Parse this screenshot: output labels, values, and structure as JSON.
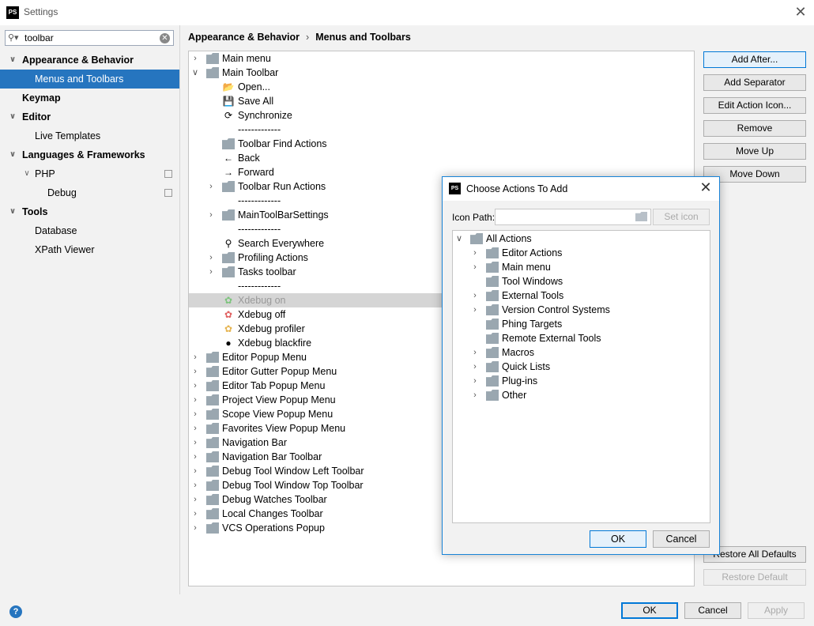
{
  "window": {
    "app_icon": "PS",
    "title": "Settings"
  },
  "search": {
    "value": "toolbar"
  },
  "sidebar": {
    "items": [
      {
        "label": "Appearance & Behavior"
      },
      {
        "label": "Menus and Toolbars"
      },
      {
        "label": "Keymap"
      },
      {
        "label": "Editor"
      },
      {
        "label": "Live Templates"
      },
      {
        "label": "Languages & Frameworks"
      },
      {
        "label": "PHP"
      },
      {
        "label": "Debug"
      },
      {
        "label": "Tools"
      },
      {
        "label": "Database"
      },
      {
        "label": "XPath Viewer"
      }
    ]
  },
  "breadcrumb": {
    "parent": "Appearance & Behavior",
    "sep": "›",
    "current": "Menus and Toolbars"
  },
  "tree": {
    "rows": [
      {
        "label": "Main menu"
      },
      {
        "label": "Main Toolbar"
      },
      {
        "label": "Open..."
      },
      {
        "label": "Save All"
      },
      {
        "label": "Synchronize"
      },
      {
        "label": "-------------"
      },
      {
        "label": "Toolbar Find Actions"
      },
      {
        "label": "Back"
      },
      {
        "label": "Forward"
      },
      {
        "label": "Toolbar Run Actions"
      },
      {
        "label": "-------------"
      },
      {
        "label": "MainToolBarSettings"
      },
      {
        "label": "-------------"
      },
      {
        "label": "Search Everywhere"
      },
      {
        "label": "Profiling Actions"
      },
      {
        "label": "Tasks toolbar"
      },
      {
        "label": "-------------"
      },
      {
        "label": "Xdebug on"
      },
      {
        "label": "Xdebug off"
      },
      {
        "label": "Xdebug profiler"
      },
      {
        "label": "Xdebug blackfire"
      },
      {
        "label": "Editor Popup Menu"
      },
      {
        "label": "Editor Gutter Popup Menu"
      },
      {
        "label": "Editor Tab Popup Menu"
      },
      {
        "label": "Project View Popup Menu"
      },
      {
        "label": "Scope View Popup Menu"
      },
      {
        "label": "Favorites View Popup Menu"
      },
      {
        "label": "Navigation Bar"
      },
      {
        "label": "Navigation Bar Toolbar"
      },
      {
        "label": "Debug Tool Window Left Toolbar"
      },
      {
        "label": "Debug Tool Window Top Toolbar"
      },
      {
        "label": "Debug Watches Toolbar"
      },
      {
        "label": "Local Changes Toolbar"
      },
      {
        "label": "VCS Operations Popup"
      }
    ]
  },
  "buttons": {
    "add_after": "Add After...",
    "add_separator": "Add Separator",
    "edit_action_icon": "Edit Action Icon...",
    "remove": "Remove",
    "move_up": "Move Up",
    "move_down": "Move Down",
    "restore_all_defaults": "Restore All Defaults",
    "restore_default": "Restore Default"
  },
  "footer": {
    "help": "?",
    "ok": "OK",
    "cancel": "Cancel",
    "apply": "Apply"
  },
  "dialog": {
    "app_icon": "PS",
    "title": "Choose Actions To Add",
    "icon_path_label": "Icon Path:",
    "set_icon": "Set icon",
    "ok": "OK",
    "cancel": "Cancel",
    "tree": [
      {
        "label": "All Actions"
      },
      {
        "label": "Editor Actions"
      },
      {
        "label": "Main menu"
      },
      {
        "label": "Tool Windows"
      },
      {
        "label": "External Tools"
      },
      {
        "label": "Version Control Systems"
      },
      {
        "label": "Phing Targets"
      },
      {
        "label": "Remote External Tools"
      },
      {
        "label": "Macros"
      },
      {
        "label": "Quick Lists"
      },
      {
        "label": "Plug-ins"
      },
      {
        "label": "Other"
      }
    ]
  },
  "colors": {
    "selection": "#2675bf",
    "accent": "#0078d7",
    "highlight_row": "#d5d5d5"
  }
}
